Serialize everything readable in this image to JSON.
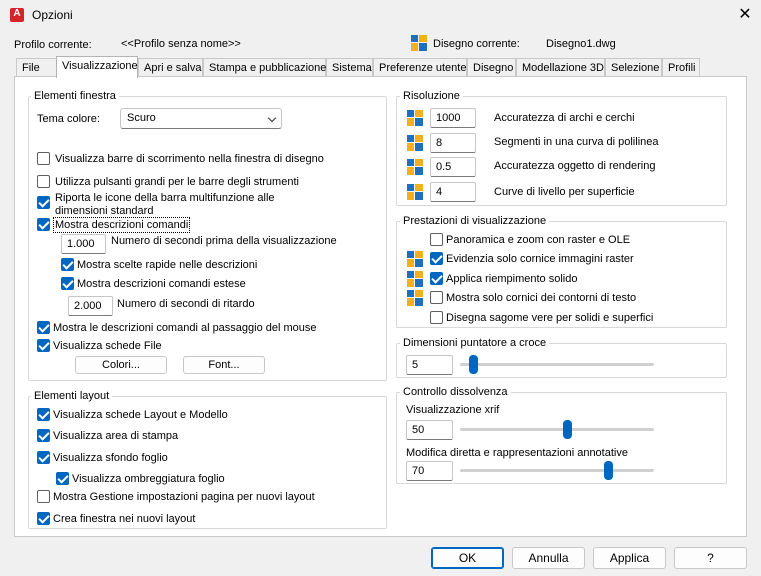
{
  "window": {
    "title": "Opzioni",
    "close": "✕"
  },
  "profile": {
    "label": "Profilo corrente:",
    "value": "<<Profilo senza nome>>",
    "drawing_label": "Disegno corrente:",
    "drawing_value": "Disegno1.dwg"
  },
  "tabs": [
    "File",
    "Visualizzazione",
    "Apri e salva",
    "Stampa e pubblicazione",
    "Sistema",
    "Preferenze utente",
    "Disegno",
    "Modellazione 3D",
    "Selezione",
    "Profili"
  ],
  "window_elements": {
    "title": "Elementi finestra",
    "theme_label": "Tema colore:",
    "theme_value": "Scuro",
    "scrollbars": "Visualizza barre di scorrimento nella finestra di disegno",
    "large_buttons": "Utilizza pulsanti grandi per le barre degli strumenti",
    "ribbon_icons_1": "Riporta le icone della barra multifunzione alle",
    "ribbon_icons_2": "dimensioni standard",
    "tooltips": "Mostra descrizioni comandi",
    "tooltip_seconds_value": "1.000",
    "tooltip_seconds_label": "Numero di secondi prima della visualizzazione",
    "shortcut_keys": "Mostra scelte rapide nelle descrizioni",
    "extended_tooltips": "Mostra descrizioni comandi estese",
    "delay_value": "2.000",
    "delay_label": "Numero di secondi di ritardo",
    "rollover": "Mostra le descrizioni comandi al passaggio del mouse",
    "file_tabs": "Visualizza schede File",
    "colors_button": "Colori...",
    "fonts_button": "Font..."
  },
  "layout_elements": {
    "title": "Elementi layout",
    "layout_tabs": "Visualizza schede Layout e Modello",
    "print_area": "Visualizza area di stampa",
    "paper_background": "Visualizza sfondo foglio",
    "paper_shadow": "Visualizza ombreggiatura foglio",
    "page_setup": "Mostra Gestione impostazioni pagina per nuovi layout",
    "viewport": "Crea finestra nei nuovi layout"
  },
  "resolution": {
    "title": "Risoluzione",
    "rows": [
      {
        "value": "1000",
        "label": "Accuratezza di archi e cerchi"
      },
      {
        "value": "8",
        "label": "Segmenti in una curva di polilinea"
      },
      {
        "value": "0.5",
        "label": "Accuratezza oggetto di rendering"
      },
      {
        "value": "4",
        "label": "Curve di livello per superficie"
      }
    ]
  },
  "performance": {
    "title": "Prestazioni di visualizzazione",
    "raster_pan": "Panoramica e zoom con raster e OLE",
    "highlight_frame": "Evidenzia solo cornice immagini raster",
    "solid_fill": "Applica riempimento solido",
    "text_frame": "Mostra solo cornici dei contorni di testo",
    "silhouettes": "Disegna sagome vere per solidi e superfici"
  },
  "crosshair": {
    "title": "Dimensioni puntatore a croce",
    "value": "5",
    "level": 5
  },
  "fade": {
    "title": "Controllo dissolvenza",
    "xref_label": "Visualizzazione xrif",
    "xref_value": "50",
    "xref_level": 50,
    "inplace_label": "Modifica diretta e rappresentazioni annotative",
    "inplace_value": "70",
    "inplace_level": 70
  },
  "footer": {
    "ok": "OK",
    "cancel": "Annulla",
    "apply": "Applica",
    "help": "?"
  },
  "colors": {
    "accent": "#0067c0",
    "icon_blue": "#1f6fbf",
    "icon_yellow": "#f2b01e",
    "app_red": "#d6242b"
  },
  "icons": {
    "app": "autocad-app-icon",
    "drawing": "drawing-file-icon",
    "setting": "drawing-setting-icon"
  }
}
